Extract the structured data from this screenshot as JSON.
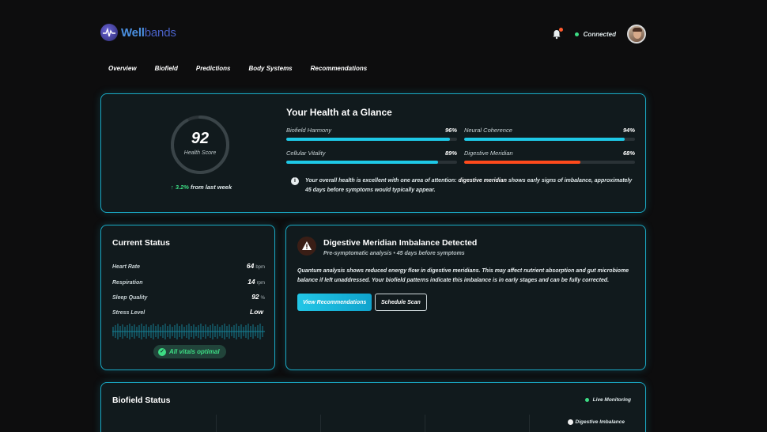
{
  "brand": {
    "name_part1": "Well",
    "name_part2": "bands"
  },
  "header": {
    "connection_status": "Connected",
    "accent": "#1aa9c4"
  },
  "nav": {
    "items": [
      "Overview",
      "Biofield",
      "Predictions",
      "Body Systems",
      "Recommendations"
    ]
  },
  "glance": {
    "title": "Your Health at a Glance",
    "score": "92",
    "score_label": "Health Score",
    "score_fraction": 0.92,
    "delta_value": "↑ 3.2%",
    "delta_text": " from last week",
    "metrics": [
      {
        "name": "Biofield Harmony",
        "value": "96%",
        "level": 0.96,
        "color": "#1ec8e6"
      },
      {
        "name": "Neural Coherence",
        "value": "94%",
        "level": 0.94,
        "color": "#1ec8e6"
      },
      {
        "name": "Cellular Vitality",
        "value": "89%",
        "level": 0.89,
        "color": "#1ec8e6"
      },
      {
        "name": "Digestive Meridian",
        "value": "68%",
        "level": 0.68,
        "color": "#ff4a1c"
      }
    ],
    "note_prefix": "Your overall health is excellent with one area of attention: ",
    "note_bold": "digestive meridian",
    "note_suffix": " shows early signs of imbalance, approximately 45 days before symptoms would typically appear."
  },
  "status": {
    "title": "Current Status",
    "vitals": [
      {
        "label": "Heart Rate",
        "value": "64",
        "unit": "bpm"
      },
      {
        "label": "Respiration",
        "value": "14",
        "unit": "rpm"
      },
      {
        "label": "Sleep Quality",
        "value": "92",
        "unit": "%"
      },
      {
        "label": "Stress Level",
        "value": "Low",
        "unit": ""
      }
    ],
    "badge": "All vitals optimal"
  },
  "alert": {
    "title": "Digestive Meridian Imbalance Detected",
    "subtitle": "Pre-symptomatic analysis • 45 days before symptoms",
    "body": "Quantum analysis shows reduced energy flow in digestive meridians. This may affect nutrient absorption and gut microbiome balance if left unaddressed. Your biofield patterns indicate this imbalance is in early stages and can be fully corrected.",
    "primary_button": "View Recommendations",
    "secondary_button": "Schedule Scan"
  },
  "biofield": {
    "title": "Biofield Status",
    "live_label": "Live Monitoring",
    "legend_item": "Digestive Imbalance"
  }
}
